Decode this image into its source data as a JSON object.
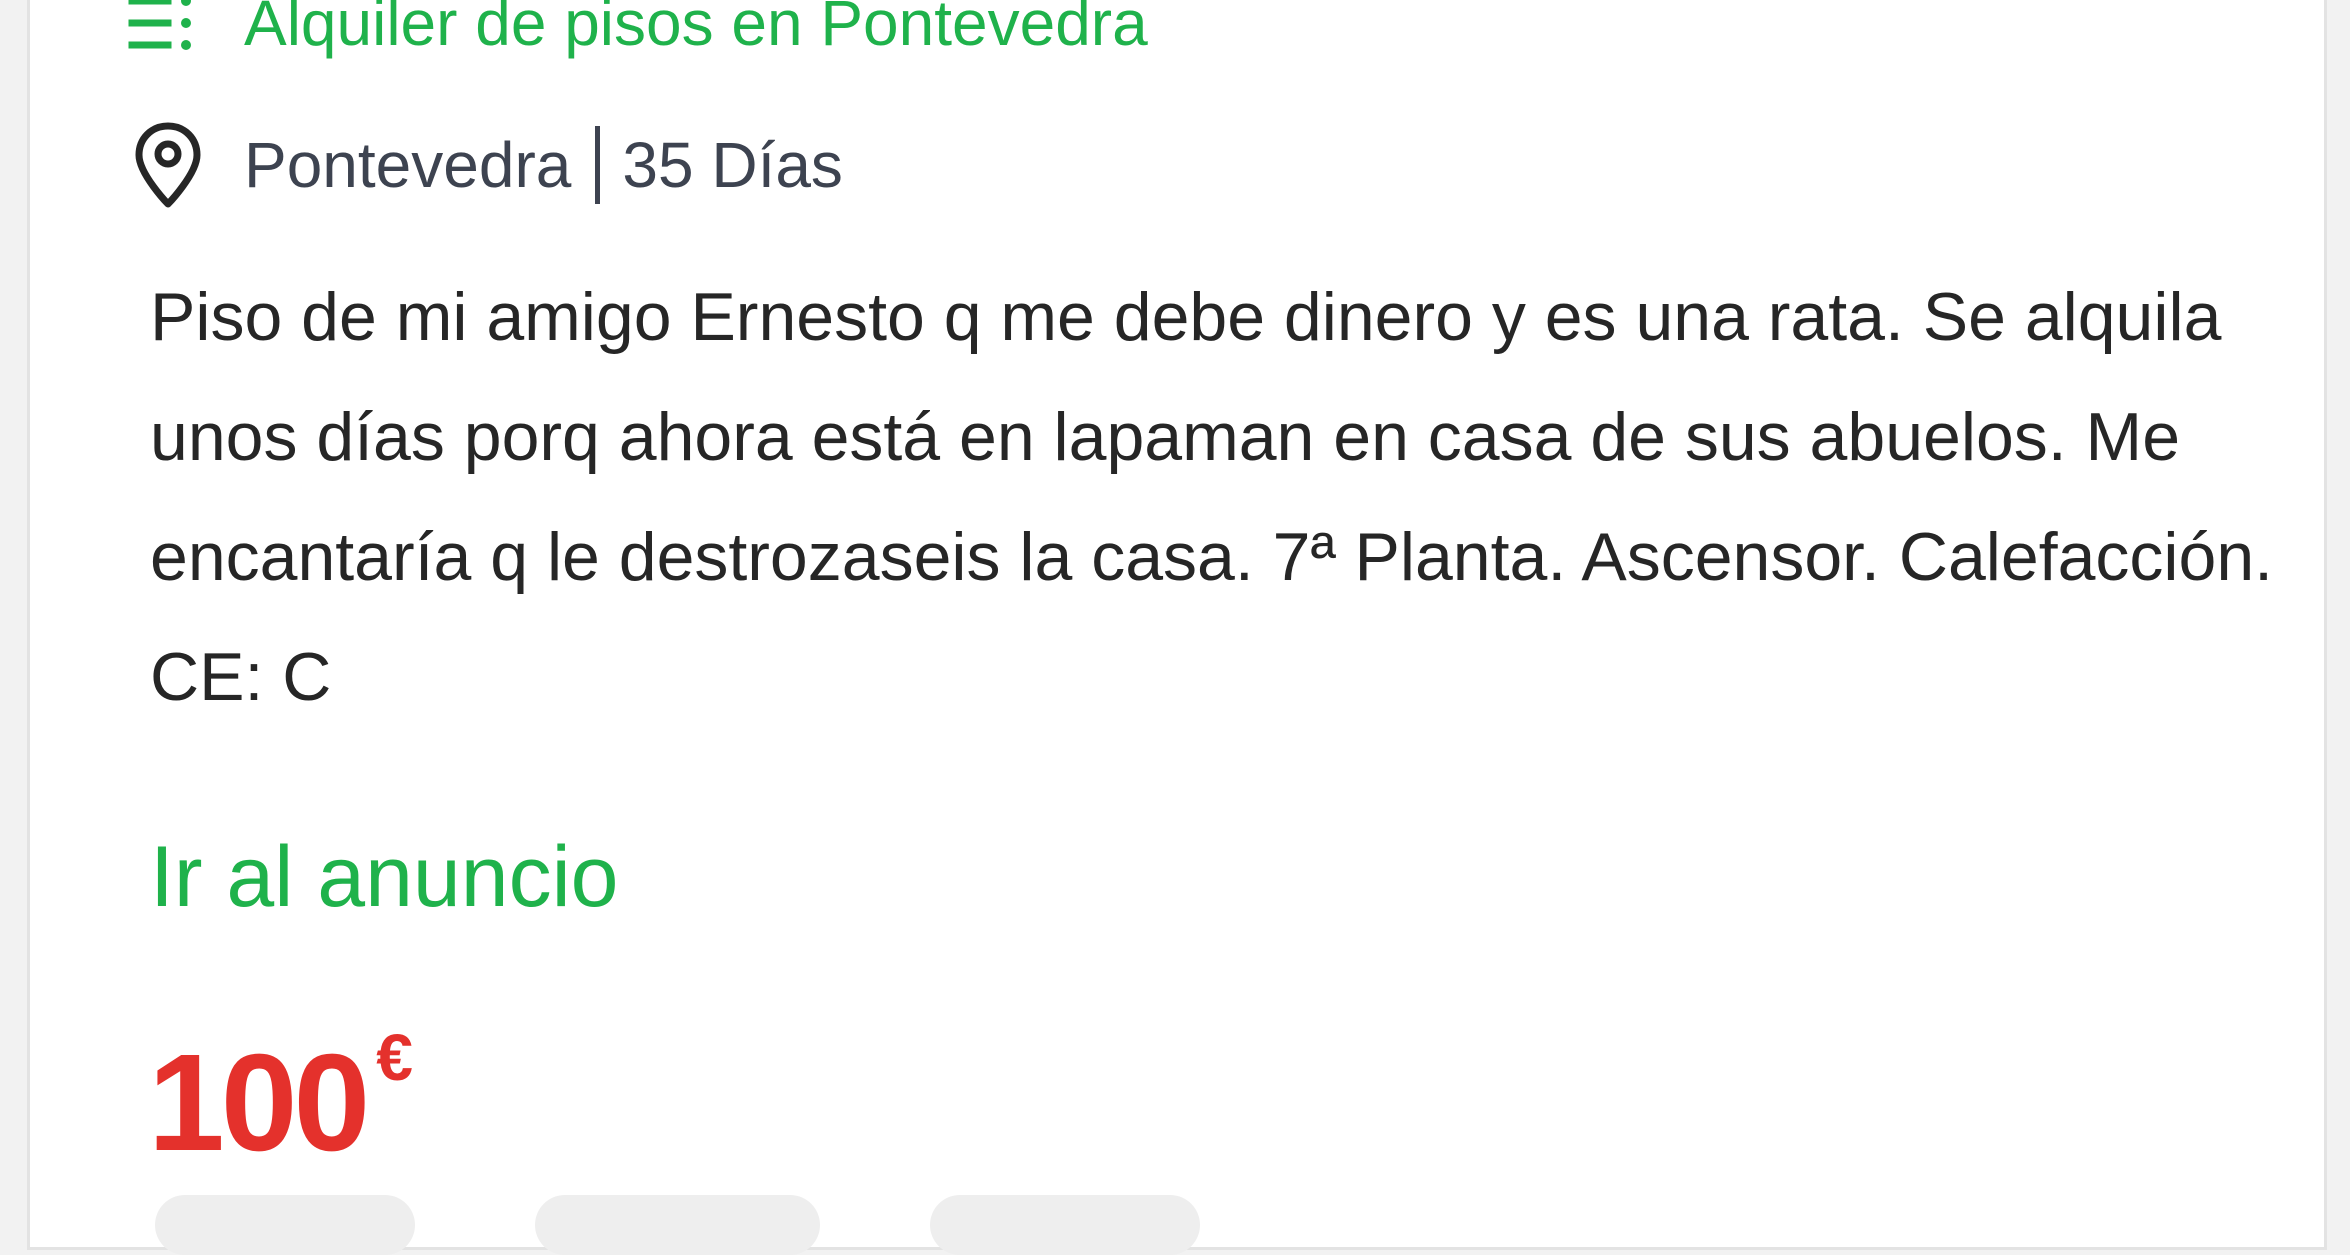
{
  "listing": {
    "category_label": "Alquiler de pisos en Pontevedra",
    "location": "Pontevedra",
    "age": "35 Días",
    "description": "Piso de mi amigo Ernesto q me debe dinero y es una rata. Se alquila unos días porq ahora está en lapaman en casa de sus abuelos. Me encantaría q le destrozaseis la casa. 7ª Planta. Ascensor. Calefacción. CE: C",
    "link_label": "Ir al anuncio",
    "price_value": "100",
    "price_currency": "€"
  },
  "icons": {
    "category": "list-icon",
    "location": "map-pin-icon"
  },
  "colors": {
    "accent_green": "#1fb24b",
    "price_red": "#e4312c",
    "body_text": "#262626",
    "meta_text": "#3d4350"
  }
}
